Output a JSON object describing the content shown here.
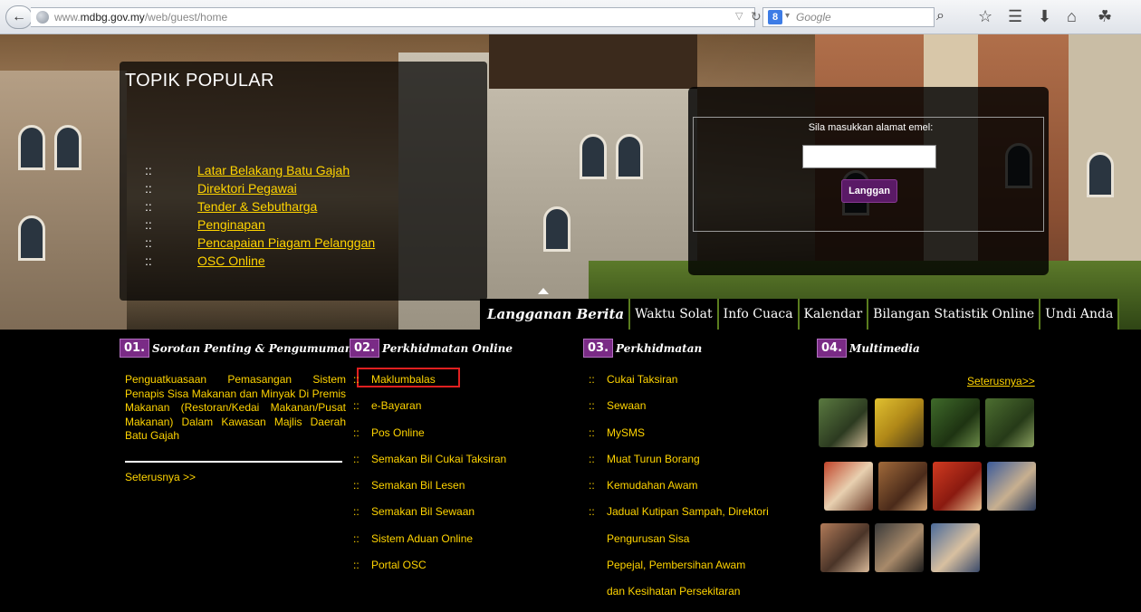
{
  "browser": {
    "url_prefix": "www.",
    "url_domain": "mdbg.gov.my",
    "url_path": "/web/guest/home",
    "search_placeholder": "Google",
    "search_engine_label": "8"
  },
  "topik": {
    "title": "TOPIK POPULAR",
    "bullet": "::",
    "items": [
      "Latar Belakang Batu Gajah",
      "Direktori Pegawai",
      "Tender & Sebutharga",
      "Penginapan",
      "Pencapaian Piagam Pelanggan",
      "OSC Online"
    ]
  },
  "subscribe": {
    "label": "Sila masukkan alamat emel:",
    "button": "Langgan",
    "email_value": ""
  },
  "tabs": [
    "Langganan Berita",
    "Waktu Solat",
    "Info Cuaca",
    "Kalendar",
    "Bilangan Statistik Online",
    "Undi Anda"
  ],
  "sections": {
    "s1": {
      "num": "01.",
      "title": "Sorotan Penting & Pengumuman",
      "body": "Penguatkuasaan Pemasangan Sistem Penapis Sisa Makanan dan Minyak Di Premis Makanan (Restoran/Kedai Makanan/Pusat Makanan) Dalam Kawasan Majlis Daerah Batu Gajah",
      "more": "Seterusnya >>"
    },
    "s2": {
      "num": "02.",
      "title": "Perkhidmatan Online",
      "bullet": "::",
      "items": [
        "Maklumbalas",
        "e-Bayaran",
        "Pos Online",
        "Semakan Bil Cukai Taksiran",
        "Semakan Bil Lesen",
        "Semakan Bil Sewaan",
        "Sistem Aduan Online",
        "Portal OSC"
      ]
    },
    "s3": {
      "num": "03.",
      "title": "Perkhidmatan",
      "bullet": "::",
      "items": [
        "Cukai Taksiran",
        "Sewaan",
        "MySMS",
        "Muat Turun Borang",
        "Kemudahan Awam",
        "Jadual Kutipan Sampah, Direktori"
      ],
      "continuation": [
        "Pengurusan Sisa",
        "Pepejal, Pembersihan Awam",
        "dan Kesihatan Persekitaran"
      ]
    },
    "s4": {
      "num": "04.",
      "title": "Multimedia",
      "more": "Seterusnya>>"
    }
  },
  "colors": {
    "link_yellow": "#ffd400",
    "accent_purple": "#7a2b86",
    "tab_separator_green": "#5a7d1e",
    "highlight_red": "#e02020"
  }
}
